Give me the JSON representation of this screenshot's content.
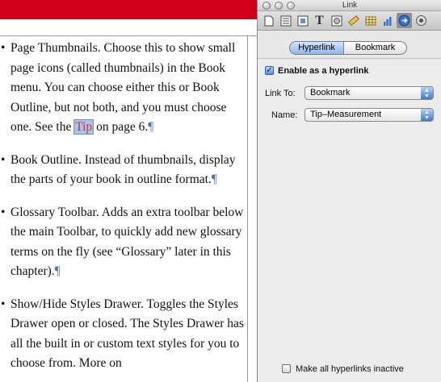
{
  "document": {
    "paragraphs": [
      {
        "bullet": "•",
        "text_before": "Page Thumbnails. Choose this to show small page icons (called thumbnails) in the Book menu. You can choose either this or Book Outline, but not both, and you must choose one. See the ",
        "highlight": "Tip",
        "text_after": " on page 6.",
        "pilcrow": "¶"
      },
      {
        "bullet": "•",
        "text_before": "Book Outline. Instead of thumbnails, display the parts of your book in outline format.",
        "highlight": "",
        "text_after": "",
        "pilcrow": "¶"
      },
      {
        "bullet": "•",
        "text_before": "Glossary Toolbar. Adds an extra toolbar below the main Toolbar, to quickly add new glossary terms on the fly (see “Glossary” later in this chapter).",
        "highlight": "",
        "text_after": "",
        "pilcrow": "¶"
      },
      {
        "bullet": "•",
        "text_before": "Show/Hide Styles Drawer. Toggles the Styles Drawer open or closed. The Styles Drawer has all the built in or custom text styles for you to choose from. More on",
        "highlight": "",
        "text_after": "",
        "pilcrow": ""
      }
    ]
  },
  "panel": {
    "title": "Link",
    "toolbar_icons": [
      {
        "name": "document-inspector-icon",
        "glyph": "▯"
      },
      {
        "name": "layout-inspector-icon",
        "glyph": "▤"
      },
      {
        "name": "wrap-inspector-icon",
        "glyph": "▦"
      },
      {
        "name": "text-inspector-icon",
        "glyph": "T"
      },
      {
        "name": "graphic-inspector-icon",
        "glyph": "◯"
      },
      {
        "name": "metrics-inspector-icon",
        "glyph": "📏"
      },
      {
        "name": "table-inspector-icon",
        "glyph": "▦"
      },
      {
        "name": "chart-inspector-icon",
        "glyph": "▂"
      },
      {
        "name": "link-inspector-icon",
        "glyph": "➜"
      },
      {
        "name": "quicktime-inspector-icon",
        "glyph": "◉"
      }
    ],
    "tabs": {
      "hyperlink": "Hyperlink",
      "bookmark": "Bookmark"
    },
    "enable_label": "Enable as a hyperlink",
    "enable_checked": true,
    "link_to_label": "Link To:",
    "link_to_value": "Bookmark",
    "name_label": "Name:",
    "name_value": "Tip–Measurement",
    "inactive_label": "Make all hyperlinks inactive",
    "inactive_checked": false,
    "colors": {
      "accent": "#3b78d2",
      "document_red": "#d0021b"
    }
  }
}
